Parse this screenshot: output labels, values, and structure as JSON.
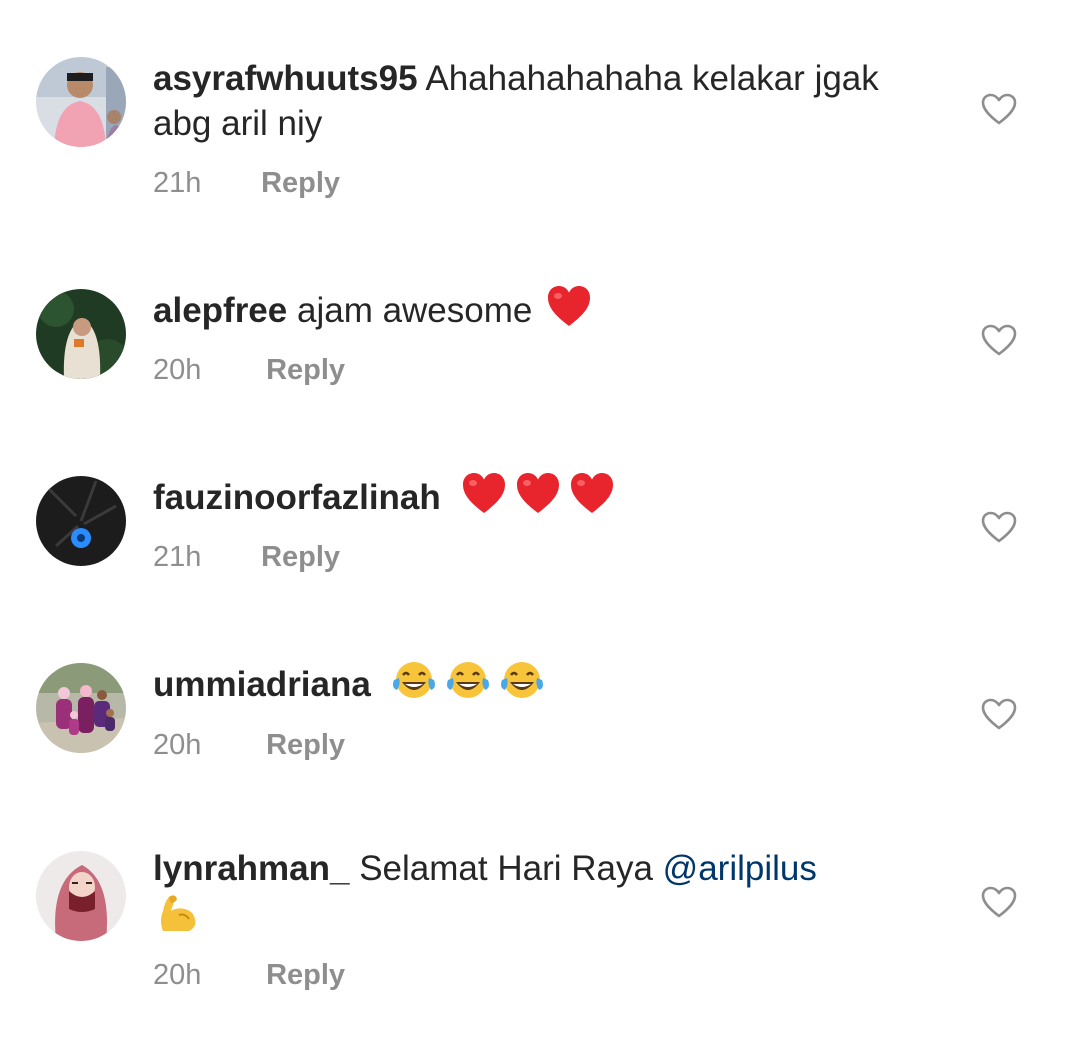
{
  "comments": [
    {
      "username": "asyrafwhuuts95",
      "text": "Ahahahahahaha kelakar jgak abg aril niy",
      "time": "21h",
      "reply_label": "Reply",
      "avatar_icon": "avatar-photo-man-pink-shirt"
    },
    {
      "username": "alepfree",
      "text": "ajam awesome",
      "emojis": [
        "red-heart"
      ],
      "time": "20h",
      "reply_label": "Reply",
      "avatar_icon": "avatar-photo-hooded-person"
    },
    {
      "username": "fauzinoorfazlinah",
      "text": "",
      "emojis": [
        "red-heart",
        "red-heart",
        "red-heart"
      ],
      "time": "21h",
      "reply_label": "Reply",
      "avatar_icon": "avatar-photo-blue-flower"
    },
    {
      "username": "ummiadriana",
      "text": "",
      "emojis": [
        "tears-of-joy",
        "tears-of-joy",
        "tears-of-joy"
      ],
      "time": "20h",
      "reply_label": "Reply",
      "avatar_icon": "avatar-photo-family"
    },
    {
      "username": "lynrahman_",
      "text": "Selamat Hari Raya",
      "mention": "@arilpilus",
      "emojis": [
        "flexed-biceps"
      ],
      "time": "20h",
      "reply_label": "Reply",
      "avatar_icon": "avatar-illustration-hijab-woman"
    }
  ],
  "colors": {
    "text": "#262626",
    "secondary": "#8e8e8e",
    "mention": "#00376b",
    "heart_emoji": "#e8242d",
    "like_outline": "#8e8e8e"
  }
}
